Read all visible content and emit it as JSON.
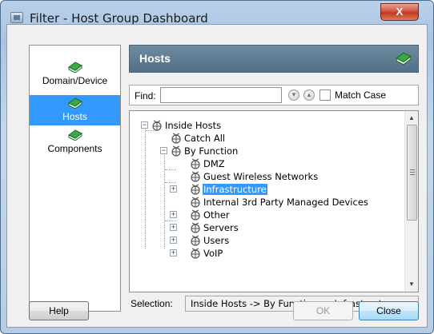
{
  "window": {
    "title": "Filter - Host Group Dashboard",
    "close_label": "X"
  },
  "nav": {
    "items": [
      {
        "label": "Domain/Device",
        "selected": false
      },
      {
        "label": "Hosts",
        "selected": true
      },
      {
        "label": "Components",
        "selected": false
      }
    ]
  },
  "header": {
    "title": "Hosts",
    "icon": "book-icon"
  },
  "find": {
    "label": "Find:",
    "value": "",
    "prev_icon": "find-previous-icon",
    "next_icon": "find-next-icon",
    "match_case_label": "Match Case",
    "match_case_checked": false
  },
  "tree": {
    "items": [
      {
        "label": "Inside Hosts",
        "expanded": true,
        "selected": false
      },
      {
        "label": "Catch All",
        "expanded": null,
        "selected": false
      },
      {
        "label": "By Function",
        "expanded": true,
        "selected": false
      },
      {
        "label": "DMZ",
        "expanded": null,
        "selected": false
      },
      {
        "label": "Guest Wireless Networks",
        "expanded": null,
        "selected": false
      },
      {
        "label": "Infrastructure",
        "expanded": false,
        "selected": true
      },
      {
        "label": "Internal 3rd Party Managed Devices",
        "expanded": null,
        "selected": false
      },
      {
        "label": "Other",
        "expanded": false,
        "selected": false
      },
      {
        "label": "Servers",
        "expanded": false,
        "selected": false
      },
      {
        "label": "Users",
        "expanded": false,
        "selected": false
      },
      {
        "label": "VoIP",
        "expanded": false,
        "selected": false
      }
    ]
  },
  "selection": {
    "label": "Selection:",
    "value": "Inside Hosts -> By Function -> Infrastructure"
  },
  "buttons": {
    "help": "Help",
    "ok": "OK",
    "close": "Close"
  },
  "colors": {
    "accent": "#3399ff",
    "header": "#5f7b92",
    "book_green": "#2e9e3c"
  }
}
